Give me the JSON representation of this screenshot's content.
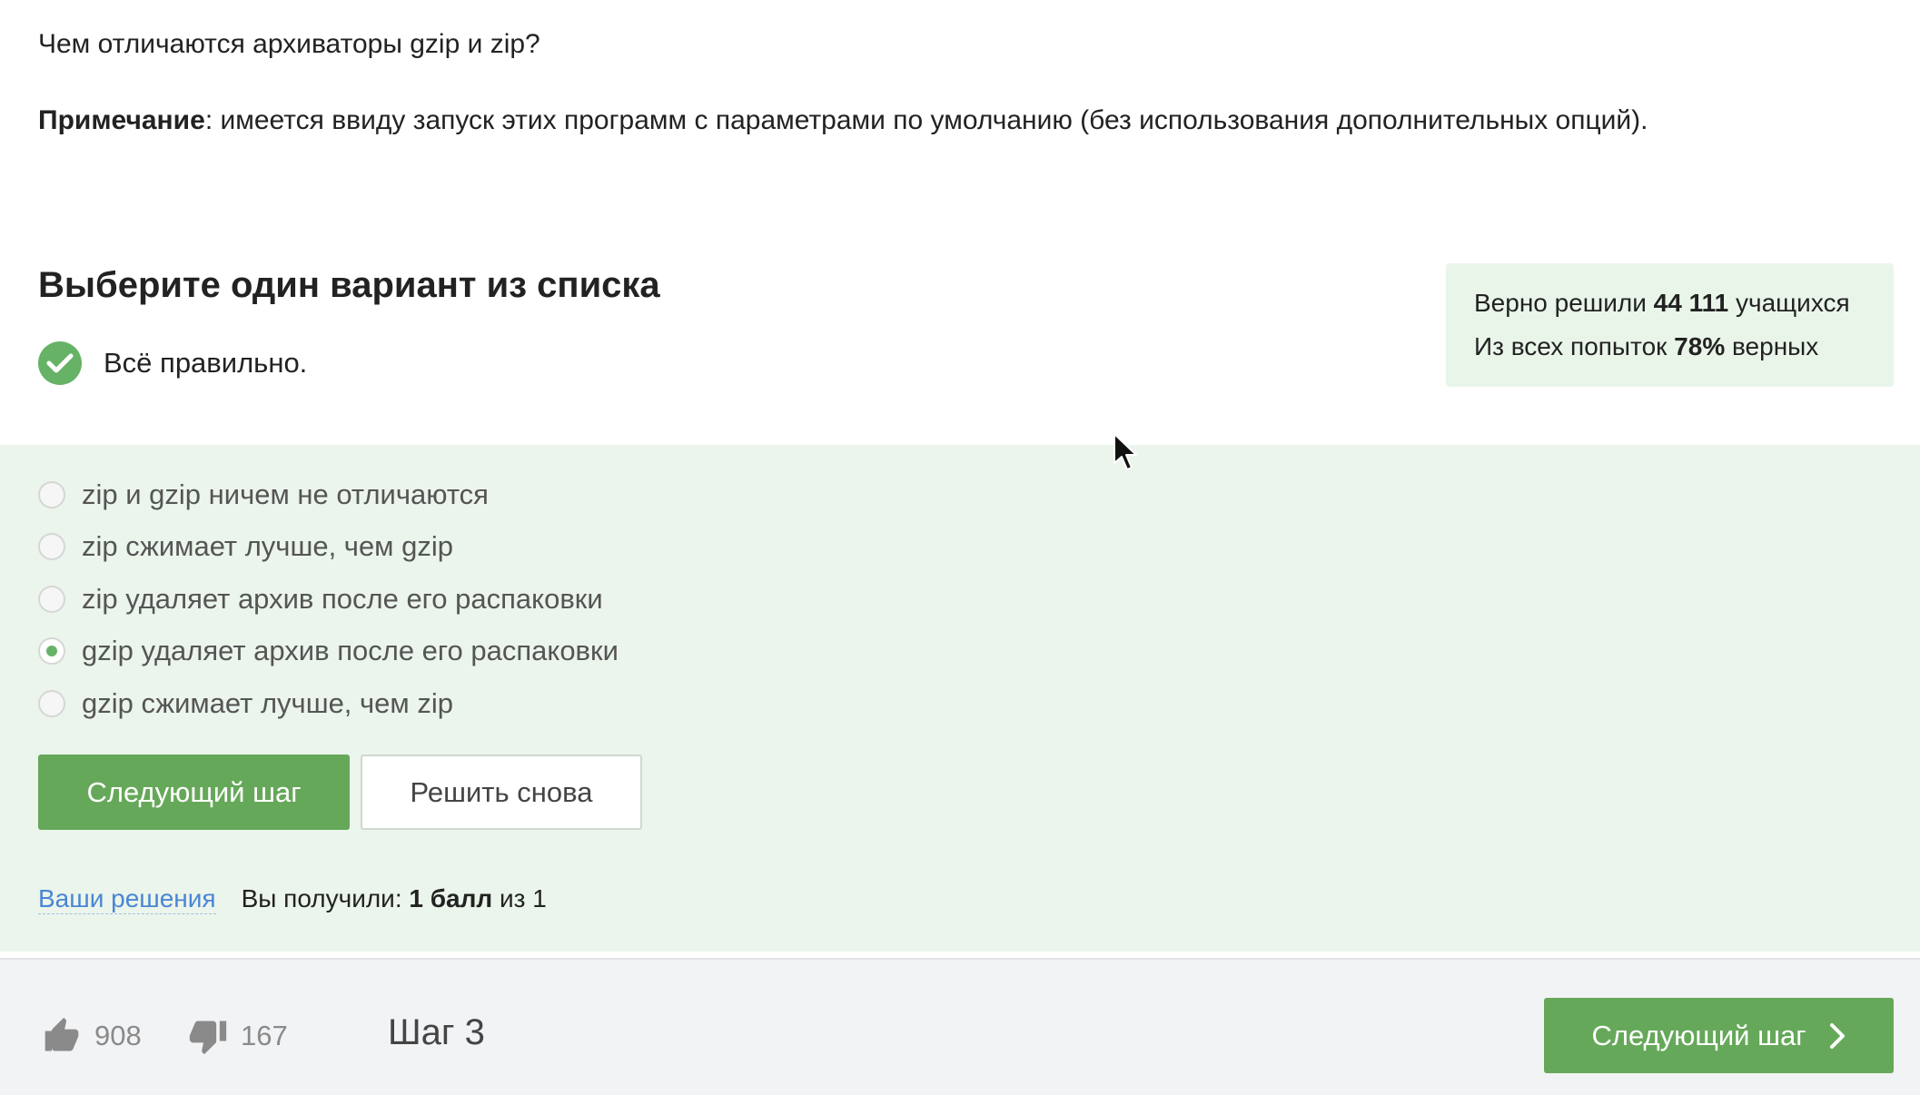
{
  "question": {
    "text": "Чем отличаются архиваторы gzip и zip?",
    "note_label": "Примечание",
    "note_text": ": имеется ввиду запуск этих программ с параметрами по умолчанию (без использования дополнительных опций)."
  },
  "task": {
    "title": "Выберите один вариант из списка",
    "status": "Всё правильно."
  },
  "stats": {
    "solved_prefix": "Верно решили ",
    "solved_count": "44 111",
    "solved_suffix": " учащихся",
    "attempts_prefix": "Из всех попыток ",
    "attempts_percent": "78%",
    "attempts_suffix": " верных"
  },
  "options": [
    {
      "label": "zip и gzip ничем не отличаются",
      "selected": false
    },
    {
      "label": "zip сжимает лучше, чем gzip",
      "selected": false
    },
    {
      "label": "zip удаляет архив после его распаковки",
      "selected": false
    },
    {
      "label": "gzip удаляет архив после его распаковки",
      "selected": true
    },
    {
      "label": "gzip сжимает лучше, чем zip",
      "selected": false
    }
  ],
  "buttons": {
    "next": "Следующий шаг",
    "retry": "Решить снова"
  },
  "result": {
    "link": "Ваши решения",
    "prefix": "Вы получили: ",
    "score": "1 балл",
    "suffix": " из 1"
  },
  "footer": {
    "likes": "908",
    "dislikes": "167",
    "step": "Шаг 3",
    "next": "Следующий шаг"
  },
  "colors": {
    "accent_green": "#66a85a",
    "panel_bg": "#ebf5eb",
    "link": "#4a86d4"
  }
}
